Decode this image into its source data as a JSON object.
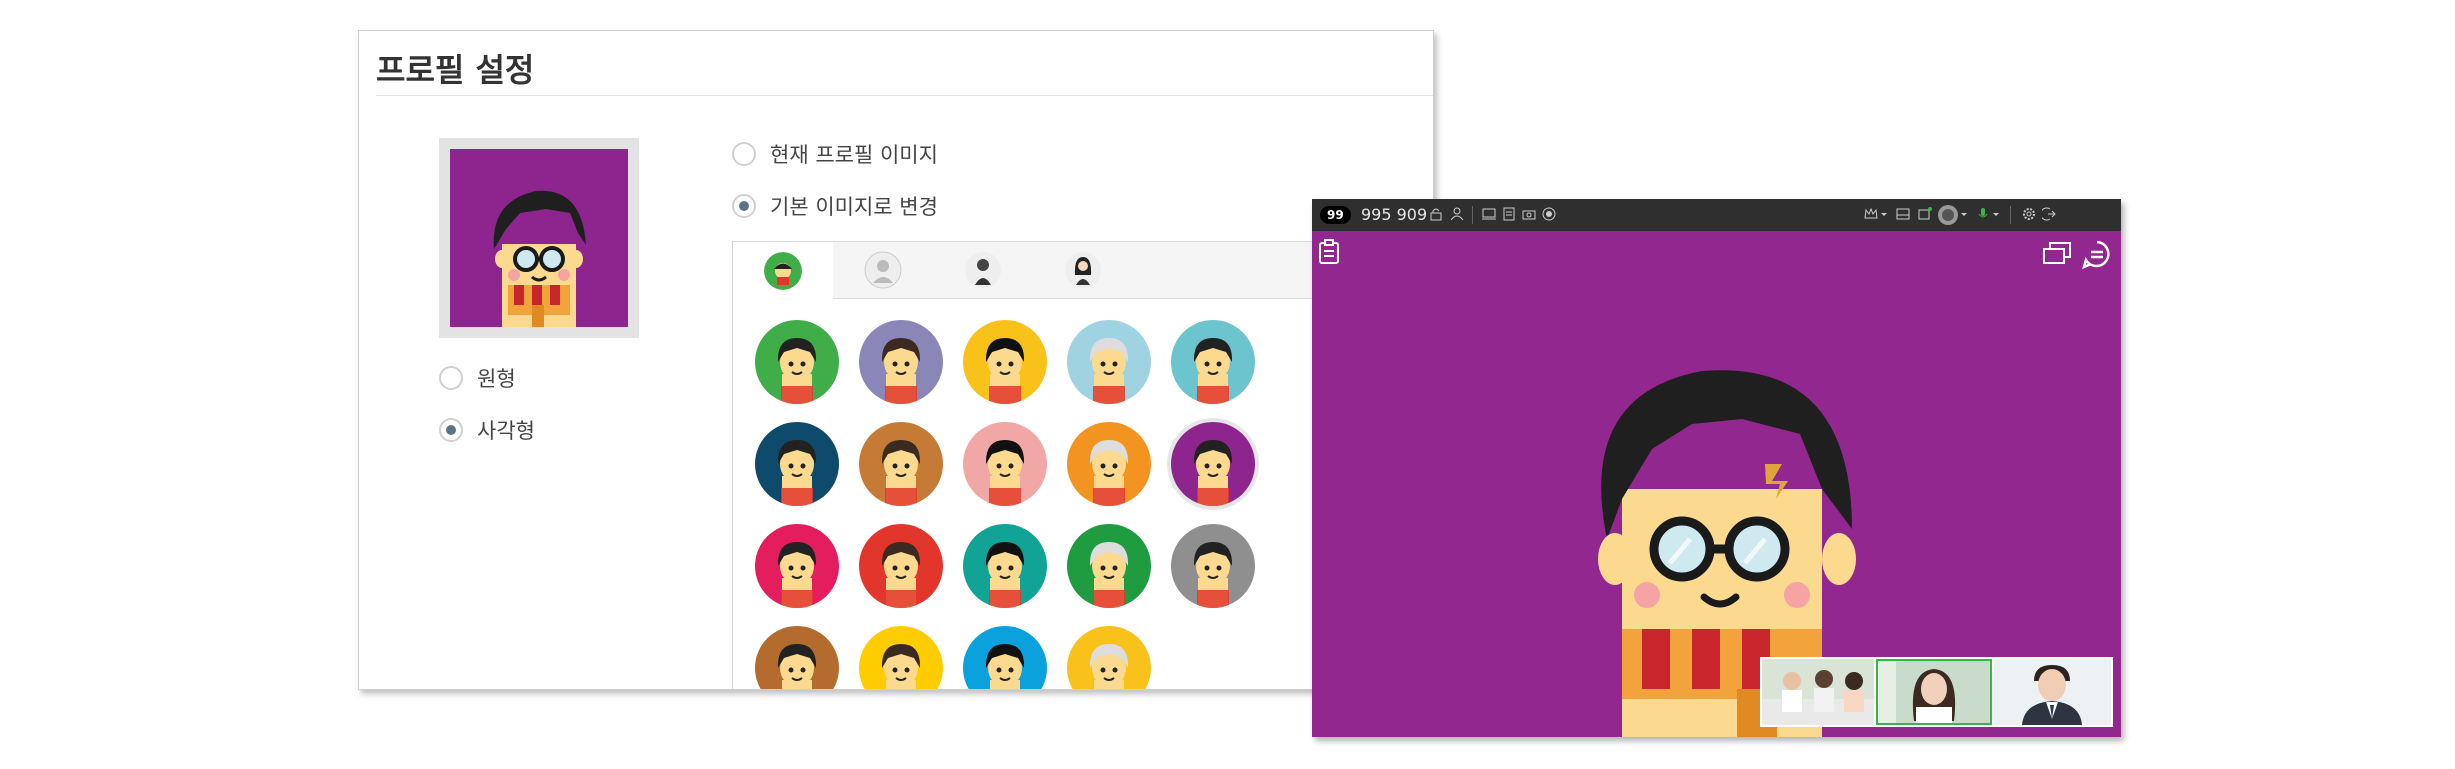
{
  "profile": {
    "title": "프로필 설정",
    "options_image": [
      {
        "label": "현재 프로필 이미지",
        "checked": false
      },
      {
        "label": "기본 이미지로 변경",
        "checked": true
      }
    ],
    "options_shape": [
      {
        "label": "원형",
        "checked": false
      },
      {
        "label": "사각형",
        "checked": true
      }
    ]
  },
  "picker": {
    "tabs": [
      "character-avatars",
      "gray-avatar",
      "illustrated-man",
      "illustrated-woman"
    ],
    "active_tab": 0,
    "avatars": [
      {
        "bg": "#3fae49",
        "name": "character-1"
      },
      {
        "bg": "#8a87b8",
        "name": "character-2"
      },
      {
        "bg": "#f8c21a",
        "name": "cat"
      },
      {
        "bg": "#9fd3e2",
        "name": "grandma"
      },
      {
        "bg": "#6cc4cf",
        "name": "sunglasses"
      },
      {
        "bg": "#0e4a6b",
        "name": "monster"
      },
      {
        "bg": "#c57a35",
        "name": "dog"
      },
      {
        "bg": "#f2a7a7",
        "name": "girl"
      },
      {
        "bg": "#f39320",
        "name": "blue-hair"
      },
      {
        "bg": "#8e258e",
        "name": "glasses-boy",
        "selected": true
      },
      {
        "bg": "#e31d5e",
        "name": "bangs"
      },
      {
        "bg": "#e2362c",
        "name": "cap"
      },
      {
        "bg": "#10a396",
        "name": "tie-man"
      },
      {
        "bg": "#1f9c3f",
        "name": "mustache"
      },
      {
        "bg": "#8f8f8f",
        "name": "bald-man"
      },
      {
        "bg": "#b36b2e",
        "name": "green-hat"
      },
      {
        "bg": "#ffcc00",
        "name": "bun-hair"
      },
      {
        "bg": "#0aa1dc",
        "name": "topknot"
      },
      {
        "bg": "#f8c21a",
        "name": "egg"
      }
    ]
  },
  "meeting": {
    "participant_count": "99",
    "room_id": "995 909",
    "bg_color": "#92278f"
  }
}
